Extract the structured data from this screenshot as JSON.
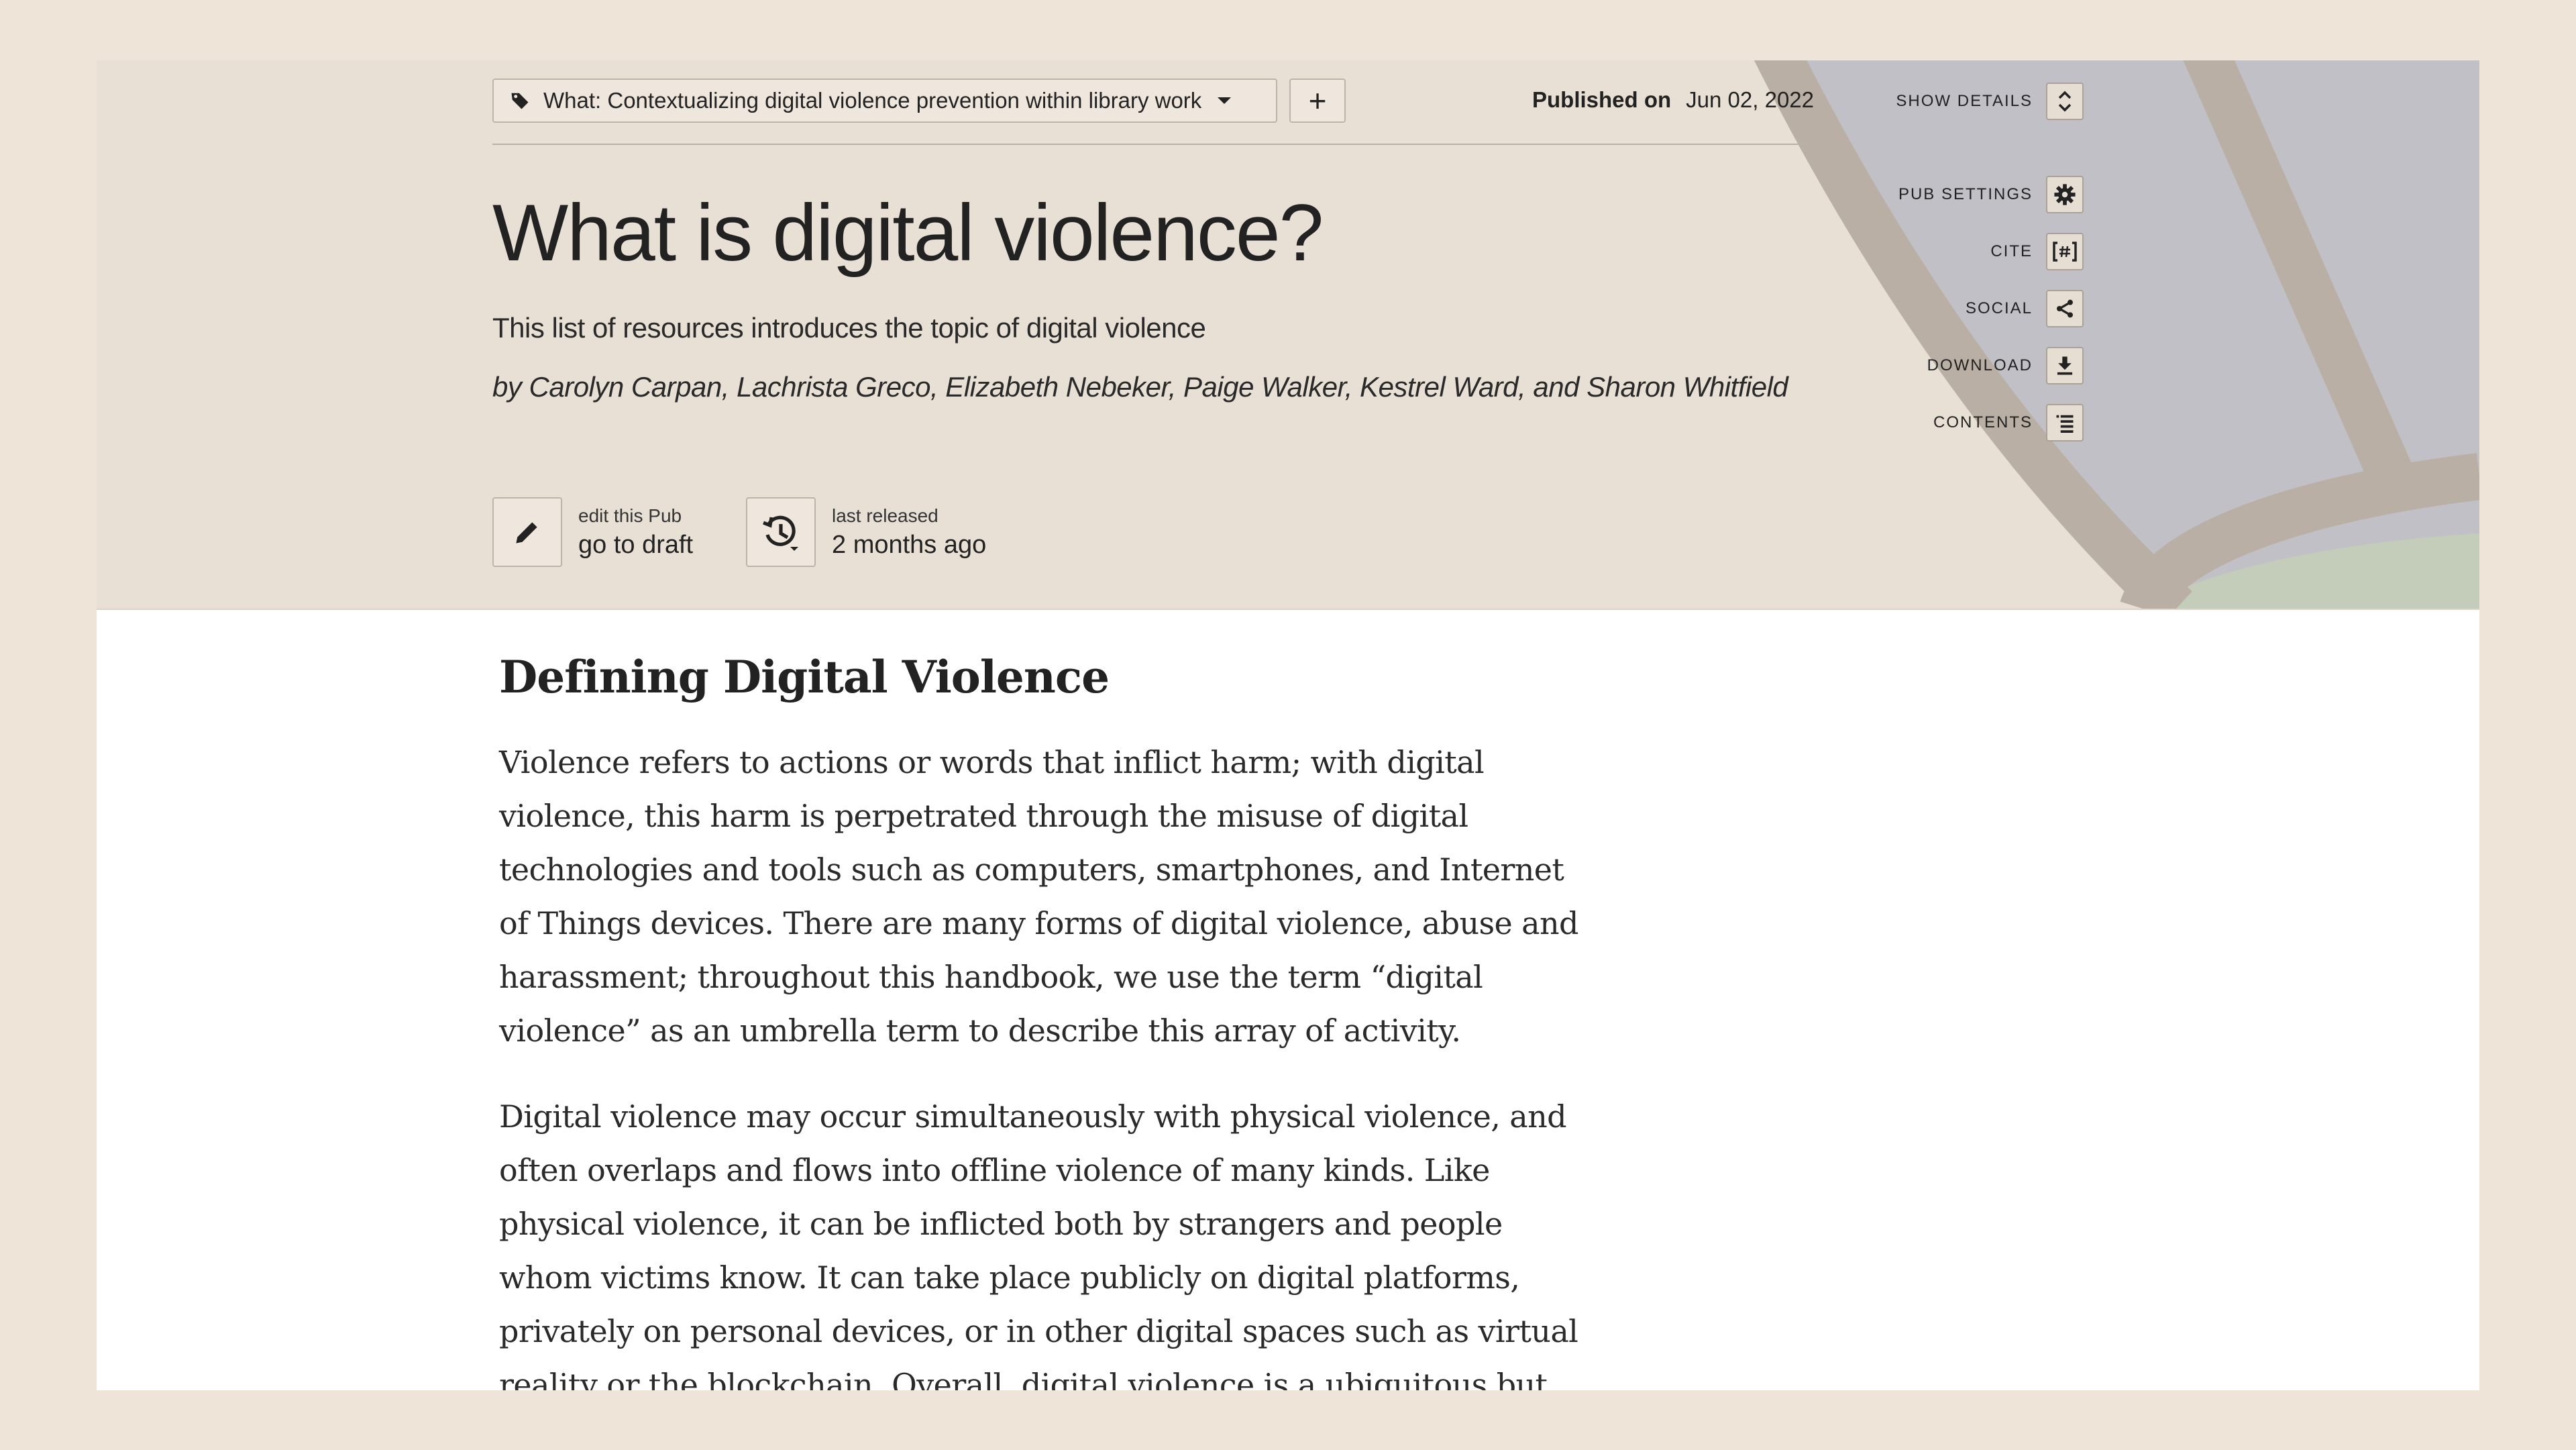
{
  "header": {
    "tag_select": {
      "label": "What: Contextualizing digital violence prevention within library work"
    },
    "add_label": "+",
    "published_label": "Published on",
    "published_date": "Jun 02, 2022",
    "title": "What is digital violence?",
    "subtitle": "This list of resources introduces the topic of digital violence",
    "byline": "by Carolyn Carpan, Lachrista Greco, Elizabeth Nebeker, Paige Walker, Kestrel Ward, and Sharon Whitfield"
  },
  "side_menu": [
    {
      "label": "SHOW DETAILS",
      "icon": "expand-icon"
    },
    {
      "label": "PUB SETTINGS",
      "icon": "gear-icon"
    },
    {
      "label": "CITE",
      "icon": "cite-icon"
    },
    {
      "label": "SOCIAL",
      "icon": "share-icon"
    },
    {
      "label": "DOWNLOAD",
      "icon": "download-icon"
    },
    {
      "label": "CONTENTS",
      "icon": "list-icon"
    }
  ],
  "actions": {
    "edit": {
      "small": "edit this Pub",
      "big": "go to draft",
      "icon": "pencil-icon"
    },
    "release": {
      "small": "last released",
      "big": "2 months ago",
      "icon": "history-icon"
    }
  },
  "content": {
    "heading": "Defining Digital Violence",
    "paragraphs": [
      "Violence refers to actions or words that inflict harm; with digital violence, this harm is perpetrated through the misuse of digital technologies and tools such as computers, smartphones, and Internet of Things devices. There are many forms of digital violence, abuse and harassment; throughout this handbook, we use the term “digital violence” as an umbrella term to describe this array of activity.",
      "Digital violence may occur simultaneously with physical violence, and often overlaps and flows into offline violence of many kinds. Like physical violence, it can be inflicted both by strangers and people whom victims know. It can take place publicly on digital platforms, privately on personal devices, or in other digital spaces such as virtual reality or the blockchain. Overall, digital violence is a ubiquitous but frequently overlooked form of harm rooted in"
    ]
  },
  "colors": {
    "page_bg": "#efe4d8",
    "header_bg": "#e8dfd5",
    "art_stroke": "#b9afa4",
    "art_blue": "#c1c0c6",
    "art_green": "#c3cdb9"
  }
}
